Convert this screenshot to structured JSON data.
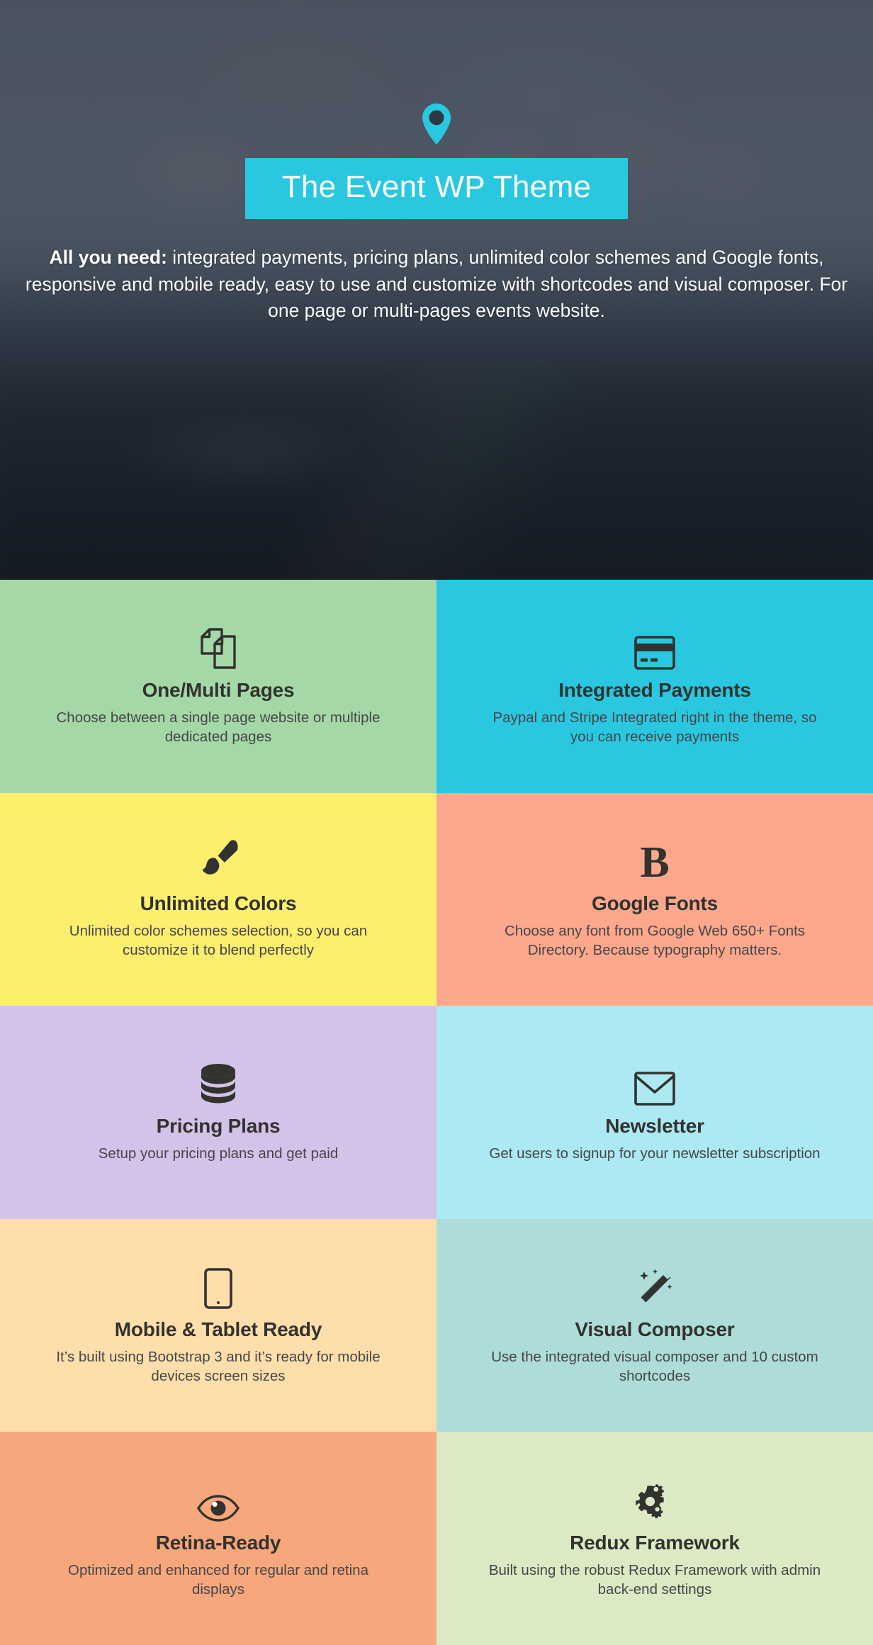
{
  "hero": {
    "pin_icon": "map-pin-icon",
    "title": "The Event WP Theme",
    "title_band_color": "#29c8e0",
    "description_lead": "All you need:",
    "description_rest": " integrated payments, pricing plans, unlimited color schemes and Google fonts, responsive and mobile ready, easy to use and customize with shortcodes and visual composer. For one page or multi-pages events website.",
    "background_overlay": "#283040"
  },
  "features": [
    {
      "icon": "copy-pages-icon",
      "title": "One/Multi Pages",
      "desc": "Choose between a single page website or multiple dedicated pages",
      "bg": "#a5d8a7"
    },
    {
      "icon": "credit-card-icon",
      "title": "Integrated Payments",
      "desc": "Paypal and Stripe Integrated right in the theme, so you can receive payments",
      "bg": "#29c8e0"
    },
    {
      "icon": "paintbrush-icon",
      "title": "Unlimited Colors",
      "desc": "Unlimited color schemes selection, so you can customize it to blend perfectly",
      "bg": "#fdef6e"
    },
    {
      "icon": "letter-b-serif-icon",
      "title": "Google Fonts",
      "desc": "Choose any font from Google Web 650+ Fonts Directory. Because typography matters.",
      "bg": "#fda88c"
    },
    {
      "icon": "coin-stack-icon",
      "title": "Pricing Plans",
      "desc": "Setup your pricing plans and get paid",
      "bg": "#d3c3e8"
    },
    {
      "icon": "envelope-icon",
      "title": "Newsletter",
      "desc": "Get users to signup for your newsletter subscription",
      "bg": "#ace9f3"
    },
    {
      "icon": "tablet-icon",
      "title": "Mobile & Tablet Ready",
      "desc": "It’s built using Bootstrap 3 and it’s ready for mobile devices screen sizes",
      "bg": "#fedfab"
    },
    {
      "icon": "magic-wand-icon",
      "title": "Visual Composer",
      "desc": "Use the integrated visual composer and 10 custom shortcodes",
      "bg": "#aedcd8"
    },
    {
      "icon": "eye-icon",
      "title": "Retina-Ready",
      "desc": "Optimized and enhanced for regular and retina displays",
      "bg": "#f6a77c"
    },
    {
      "icon": "gears-icon",
      "title": "Redux Framework",
      "desc": "Built using the robust Redux Framework with admin back-end settings",
      "bg": "#dbeac3"
    }
  ]
}
